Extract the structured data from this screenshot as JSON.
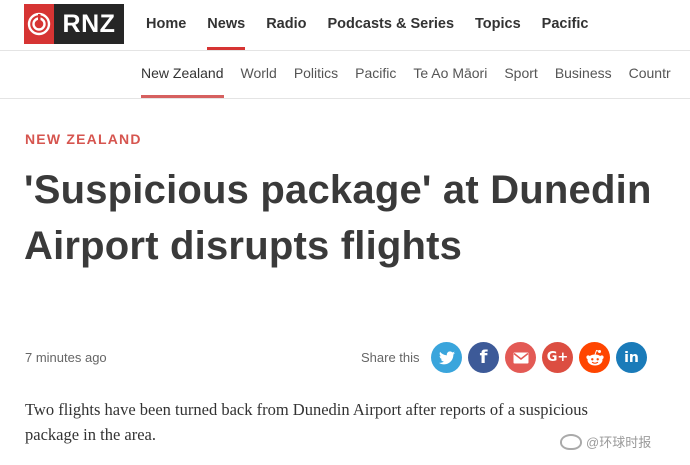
{
  "logo": {
    "text": "RNZ"
  },
  "main_nav": {
    "items": [
      "Home",
      "News",
      "Radio",
      "Podcasts & Series",
      "Topics",
      "Pacific"
    ],
    "active": "News"
  },
  "sub_nav": {
    "items": [
      "New Zealand",
      "World",
      "Politics",
      "Pacific",
      "Te Ao Māori",
      "Sport",
      "Business",
      "Countr"
    ],
    "active": "New Zealand"
  },
  "article": {
    "section": "NEW ZEALAND",
    "headline": "'Suspicious package' at Dunedin Airport disrupts flights",
    "timestamp": "7 minutes ago",
    "share_label": "Share this",
    "share_buttons": [
      {
        "icon": "twitter-icon",
        "color": "#3aa5dc",
        "glyph": "t"
      },
      {
        "icon": "facebook-icon",
        "color": "#3d5a98",
        "glyph": "f"
      },
      {
        "icon": "email-icon",
        "color": "#e35a55",
        "glyph": "✉"
      },
      {
        "icon": "google-plus-icon",
        "color": "#dc4e41",
        "glyph": "G+"
      },
      {
        "icon": "reddit-icon",
        "color": "#ff4500",
        "glyph": "r"
      },
      {
        "icon": "linkedin-icon",
        "color": "#1a7bb9",
        "glyph": "in"
      }
    ],
    "lede": "Two flights have been turned back from Dunedin Airport after reports of a suspicious package in the area."
  },
  "watermark": {
    "text": "@环球时报"
  },
  "colors": {
    "brand_red": "#d63433",
    "logo_dark": "#262626",
    "section_red": "#d6554f"
  }
}
